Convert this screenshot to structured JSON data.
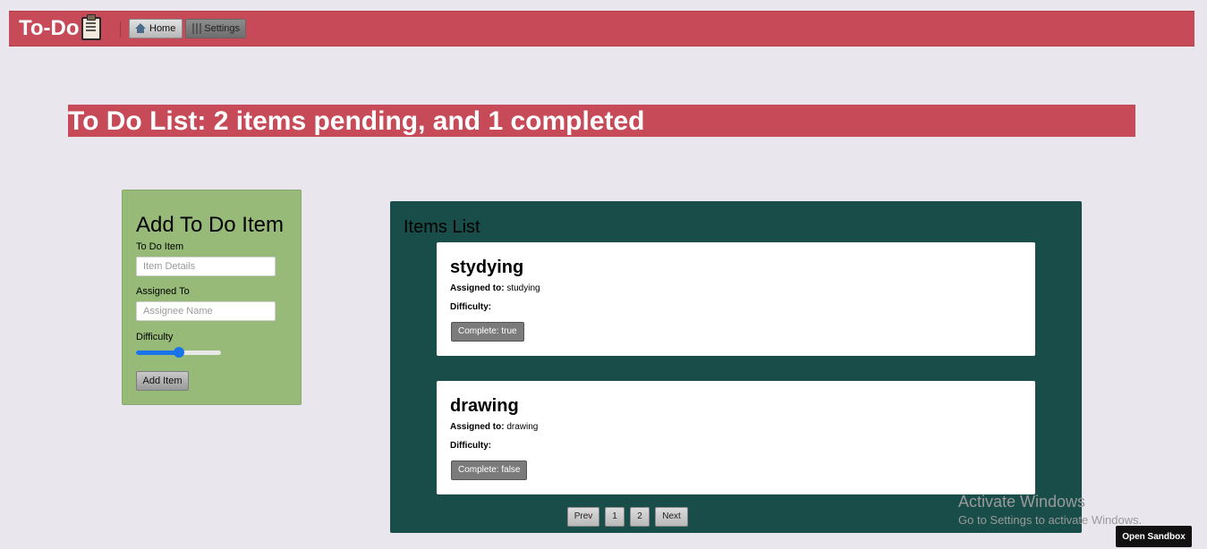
{
  "navbar": {
    "brand": "To-Do",
    "home_label": "Home",
    "settings_label": "Settings"
  },
  "header": {
    "title": "To Do List: 2 items pending, and 1 completed"
  },
  "form": {
    "heading": "Add To Do Item",
    "item_label": "To Do Item",
    "item_placeholder": "Item Details",
    "assignee_label": "Assigned To",
    "assignee_placeholder": "Assignee Name",
    "difficulty_label": "Difficulty",
    "difficulty_value": 0.5,
    "submit_label": "Add Item"
  },
  "items_list": {
    "heading": "Items List",
    "items": [
      {
        "title": "stydying",
        "assigned_label": "Assigned to:",
        "assigned_to": "studying",
        "difficulty_label": "Difficulty:",
        "complete_label": "Complete: true"
      },
      {
        "title": "drawing",
        "assigned_label": "Assigned to:",
        "assigned_to": "drawing",
        "difficulty_label": "Difficulty:",
        "complete_label": "Complete: false"
      }
    ],
    "pagination": {
      "prev": "Prev",
      "pages": [
        "1",
        "2"
      ],
      "next": "Next"
    }
  },
  "watermark": {
    "line1": "Activate Windows",
    "line2": "Go to Settings to activate Windows."
  },
  "sandbox_button": "Open Sandbox",
  "colors": {
    "accent": "#c64a57",
    "background": "#e9e6ee",
    "form_bg": "#97ba79",
    "panel_bg": "#184d49",
    "slider": "#1a73e8"
  }
}
